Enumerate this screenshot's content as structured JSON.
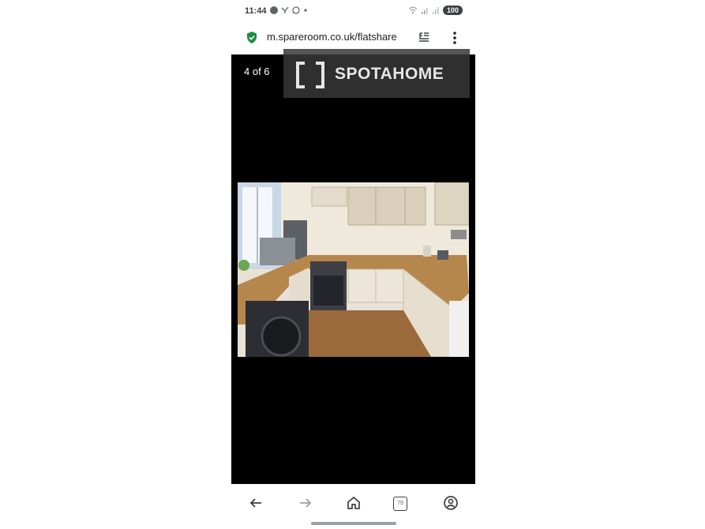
{
  "status_bar": {
    "time": "11:44",
    "battery": "100",
    "icons": [
      "notification-icon",
      "twitter-icon",
      "whatsapp-icon",
      "dot-icon",
      "wifi-icon",
      "signal-icon",
      "battery-icon"
    ]
  },
  "url_bar": {
    "url": "m.spareroom.co.uk/flatshare",
    "colors": {
      "shield": "#1e8e3e"
    }
  },
  "viewer": {
    "counter": "4 of 6",
    "logo_text": "SPOTAHOME",
    "background": "#000000"
  },
  "bottom_nav": {
    "tab_count": "79",
    "items": [
      "back-icon",
      "forward-icon",
      "home-icon",
      "tabs-icon",
      "account-icon"
    ]
  }
}
